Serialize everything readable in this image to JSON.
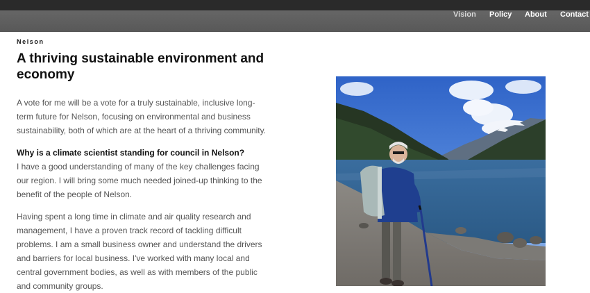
{
  "header": {
    "nav": [
      {
        "label": "Vision",
        "active": true
      },
      {
        "label": "Policy",
        "active": false
      },
      {
        "label": "About",
        "active": false
      },
      {
        "label": "Contact",
        "active": false
      }
    ]
  },
  "main": {
    "brand": "Nelson",
    "headline": "A thriving sustainable environment and economy",
    "intro": "A vote for me will be a vote for a truly sustainable, inclusive long-term future for Nelson, focusing on environmental and business sustainability, both of which are at the heart of a thriving community.",
    "question": "Why is a climate scientist standing for council in Nelson?",
    "answer_1": "I have a good understanding of many of the key challenges facing our region. I will bring some much needed joined-up thinking to the benefit of the people of Nelson.",
    "answer_2": "Having spent a long time in climate and air quality research and management, I have a proven track record of tackling difficult problems. I am a small business owner and understand the drivers and barriers for local business. I've worked with many local and central government bodies, as well as with members of the public and community groups."
  },
  "colors": {
    "nav_bar": "#5f5f5f",
    "top_strip": "#2a2a2a",
    "heading": "#111111",
    "body_text": "#555555"
  }
}
